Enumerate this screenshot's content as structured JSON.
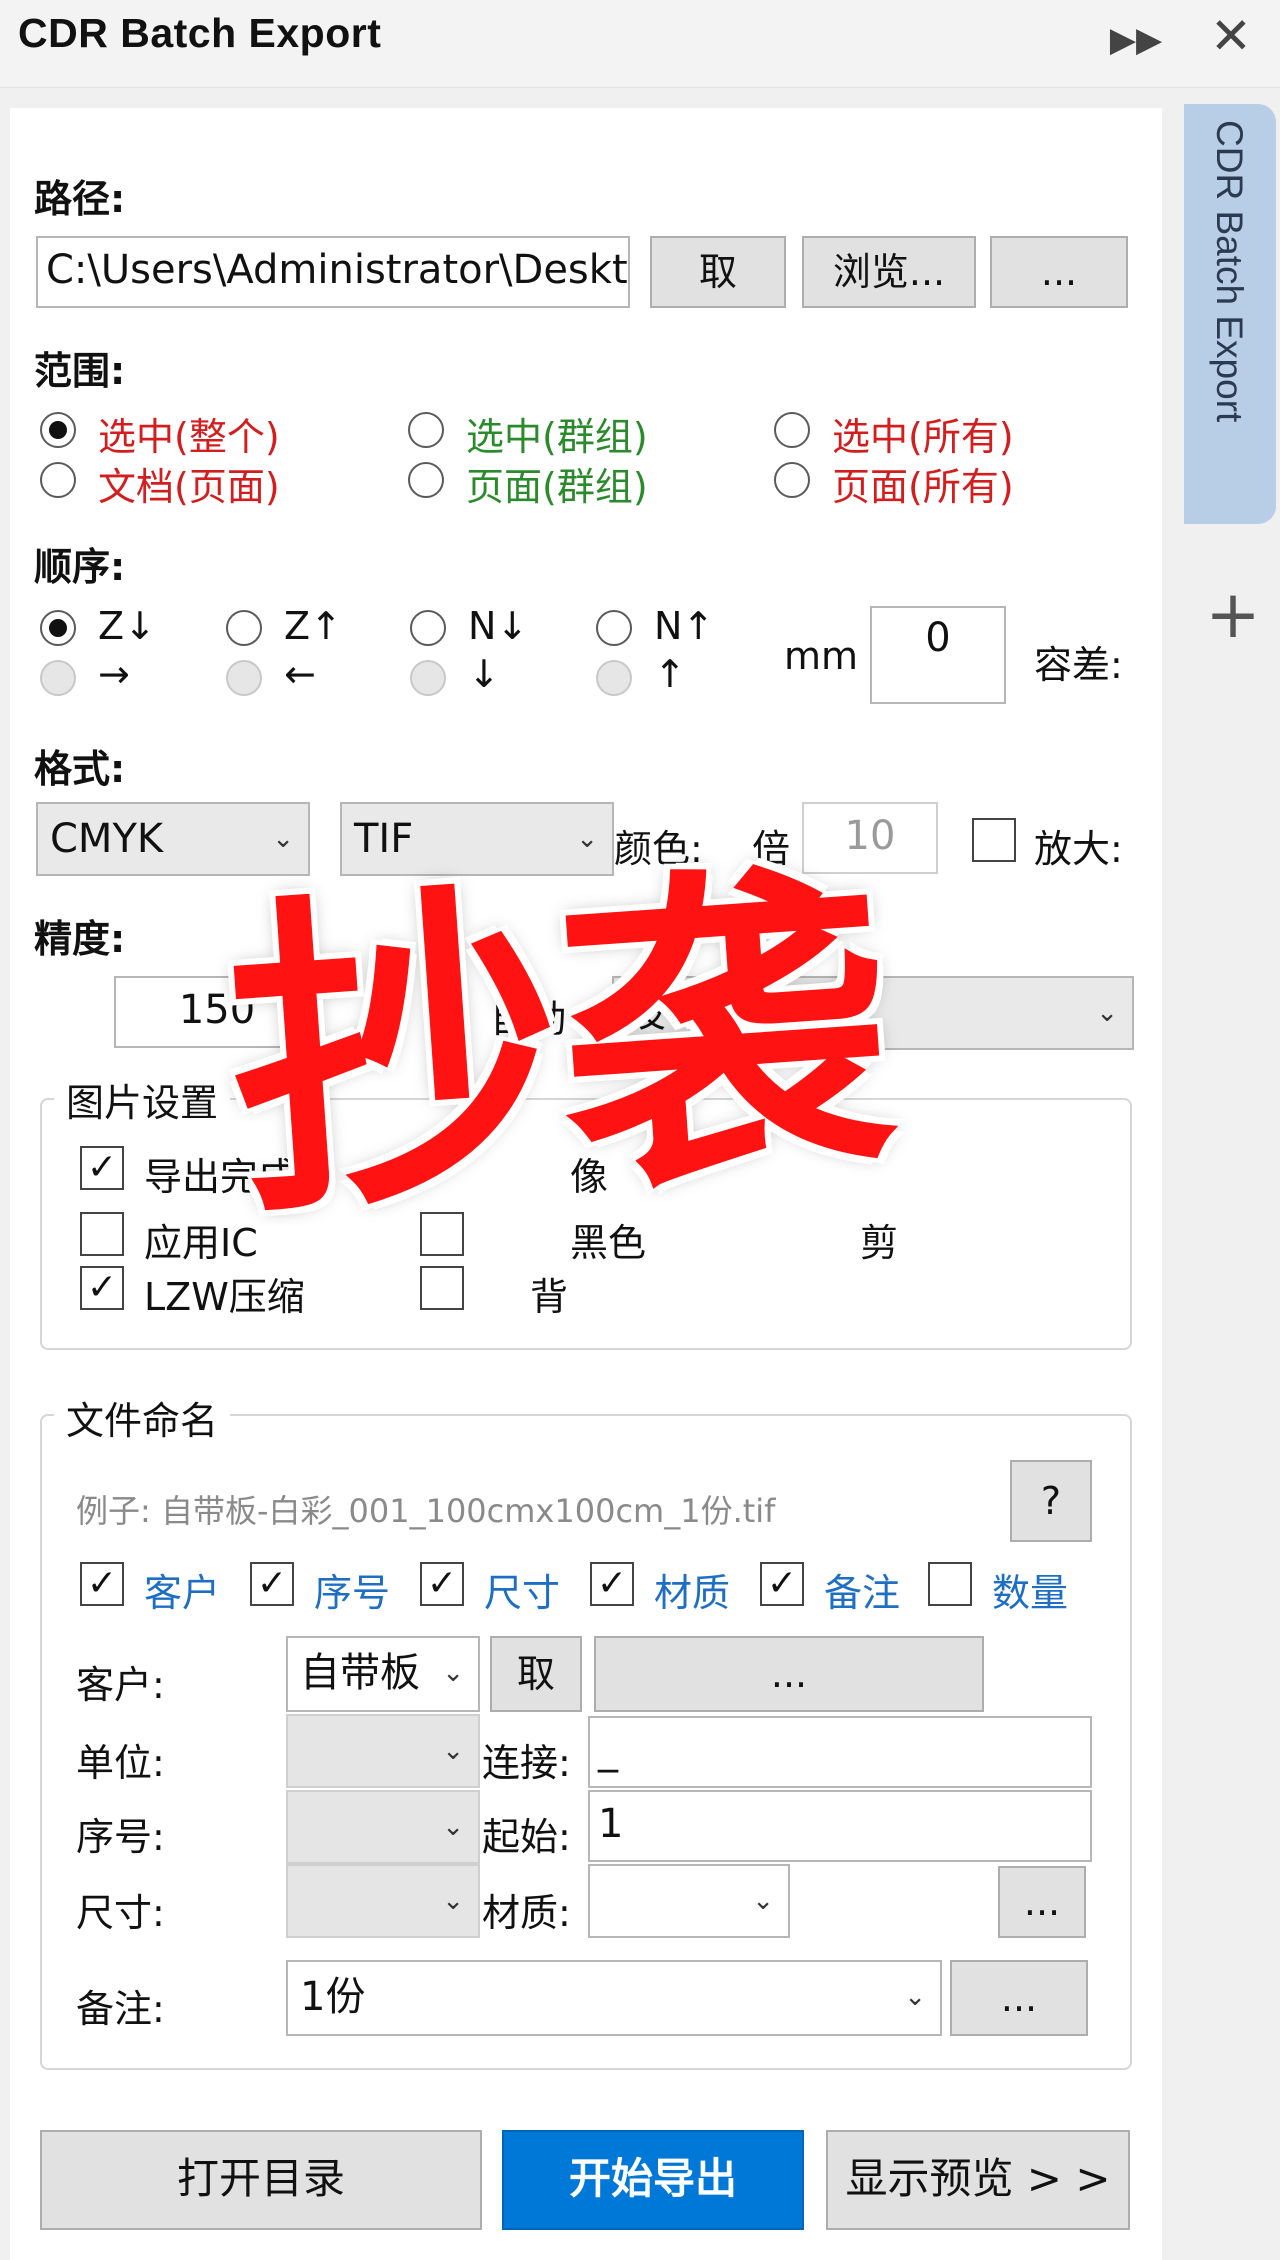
{
  "window": {
    "title": "CDR Batch Export",
    "side_tab": "CDR Batch Export",
    "plus_symbol": "+",
    "pin_symbol": "▶▶",
    "close_symbol": "✕"
  },
  "path_section": {
    "label": "路径:",
    "value": "C:\\Users\\Administrator\\Desktop",
    "btn_get": "取",
    "btn_browse": "浏览...",
    "btn_more": "..."
  },
  "range_section": {
    "label": "范围:",
    "options": [
      "选中(整个)",
      "选中(群组)",
      "选中(所有)",
      "文档(页面)",
      "页面(群组)",
      "页面(所有)"
    ],
    "colors": {
      "red": "#d21e1e",
      "green": "#2b8a2b"
    }
  },
  "order_section": {
    "label": "顺序:",
    "row1": [
      "Z↓",
      "Z↑",
      "N↓",
      "N↑"
    ],
    "row2": [
      "→",
      "←",
      "↓",
      "↑"
    ],
    "tolerance_value": "0",
    "tolerance_unit": "mm",
    "tolerance_label": "容差:"
  },
  "format_section": {
    "label": "格式:",
    "color_mode": "CMYK",
    "file_type": "TIF",
    "color_label": "颜色:",
    "scale_label": "倍",
    "scale_value": "10",
    "enlarge_label": "放大:"
  },
  "precision_section": {
    "label": "精度:",
    "dpi": "150",
    "partial_label": "自动",
    "partial_combo": "设"
  },
  "image_settings": {
    "legend": "图片设置",
    "checks": [
      "导出完成",
      "应用IC",
      "LZW压缩",
      "像",
      "黑色",
      "背",
      "剪"
    ],
    "check_marks": {
      "on": "✓",
      "off": ""
    }
  },
  "naming": {
    "legend": "文件命名",
    "example": "例子: 自带板-白彩_001_100cmx100cm_1份.tif",
    "help": "?",
    "fields": [
      "客户",
      "序号",
      "尺寸",
      "材质",
      "备注",
      "数量"
    ],
    "labels": {
      "customer": "客户:",
      "unit": "单位:",
      "seq": "序号:",
      "size": "尺寸:",
      "note": "备注:",
      "connect": "连接:",
      "start": "起始:",
      "material": "材质:"
    },
    "customer_value": "自带板",
    "btn_get": "取",
    "btn_more": "...",
    "connect_value": "_",
    "start_value": "1",
    "note_value": "1份"
  },
  "footer": {
    "open_dir": "打开目录",
    "start_export": "开始导出",
    "show_preview": "显示预览 > >",
    "accent": "#0078d7"
  },
  "watermark": "抄袭",
  "icons": {
    "dropdown": "⌄"
  }
}
